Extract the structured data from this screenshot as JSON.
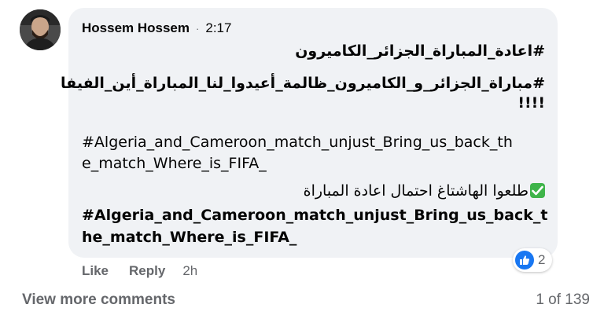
{
  "comment": {
    "author": "Hossem Hossem",
    "separator": "·",
    "time": "2:17",
    "lines": {
      "ar1": "#اعادة_المباراة_الجزائر_الكاميرون",
      "ar2": "#مباراة_الجزائر_و_الكاميرون_ظالمة_أعيدوا_لنا_المباراة_أين_الفيفا",
      "ar2b": "!!!!",
      "en1a": "#Algeria_and_Cameroon_match_unjust_Bring_us_back_th",
      "en1b": "e_match_Where_is_FIFA_",
      "ar3": "طلعوا الهاشتاغ احتمال اعادة المباراة",
      "en2a": "#Algeria_and_Cameroon_match_unjust_Bring_us_back_t",
      "en2b": "he_match_Where_is_FIFA_"
    },
    "reactions": {
      "icon": "like-icon",
      "count": "2",
      "color": "#1877f2"
    },
    "actions": {
      "like": "Like",
      "reply": "Reply",
      "age": "2h"
    }
  },
  "footer": {
    "view_more": "View more comments",
    "pager": "1 of 139"
  },
  "colors": {
    "bubble": "#f0f2f5",
    "secondary_text": "#65676b",
    "check": "#3fb44a"
  }
}
